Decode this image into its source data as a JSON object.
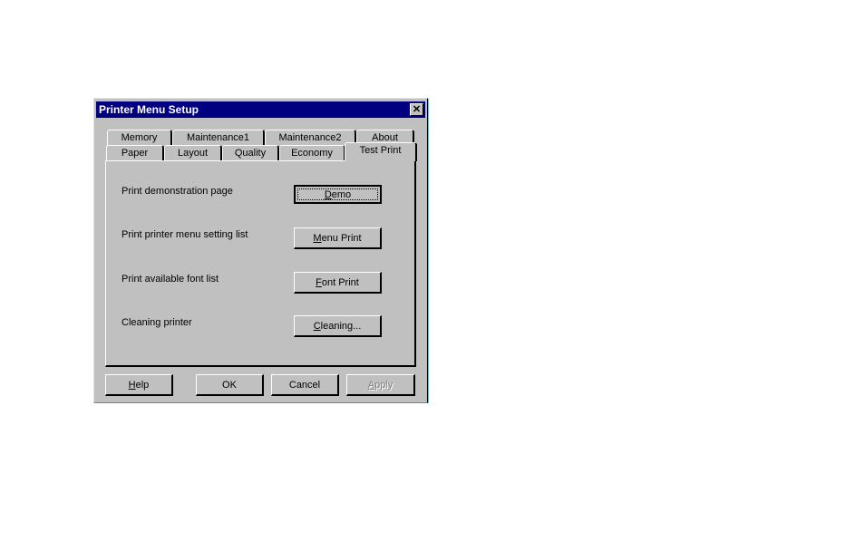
{
  "dialog": {
    "title": "Printer Menu Setup",
    "close_icon": "close-icon",
    "tabs_back_row": [
      {
        "label": "Memory"
      },
      {
        "label": "Maintenance1"
      },
      {
        "label": "Maintenance2"
      },
      {
        "label": "About"
      }
    ],
    "tabs_front_row": [
      {
        "label": "Paper"
      },
      {
        "label": "Layout"
      },
      {
        "label": "Quality"
      },
      {
        "label": "Economy"
      },
      {
        "label": "Test Print",
        "active": true
      }
    ],
    "active_tab": "Test Print",
    "rows": [
      {
        "label": "Print demonstration page",
        "button": {
          "accel": "D",
          "rest": "emo",
          "full": "Demo",
          "default": true
        }
      },
      {
        "label": "Print printer menu setting list",
        "button": {
          "accel": "M",
          "rest": "enu Print",
          "full": "Menu Print"
        }
      },
      {
        "label": "Print available font list",
        "button": {
          "accel": "F",
          "rest": "ont Print",
          "full": "Font Print"
        }
      },
      {
        "label": "Cleaning printer",
        "button": {
          "accel": "C",
          "rest": "leaning...",
          "full": "Cleaning..."
        }
      }
    ],
    "footer": {
      "help": {
        "accel": "H",
        "rest": "elp"
      },
      "ok": "OK",
      "cancel": "Cancel",
      "apply": {
        "accel": "A",
        "rest": "pply",
        "disabled": true
      }
    }
  }
}
